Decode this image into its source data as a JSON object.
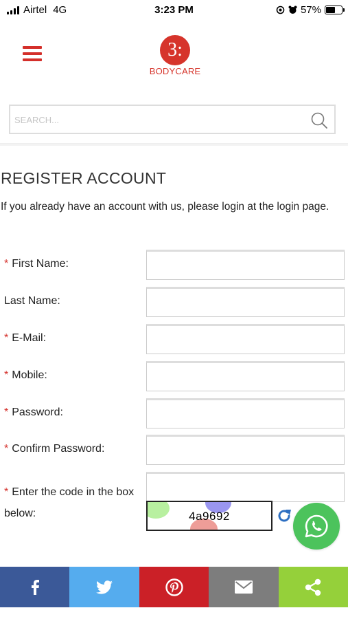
{
  "status_bar": {
    "carrier": "Airtel",
    "network": "4G",
    "time": "3:23 PM",
    "battery_percent": "57%",
    "battery_level": 0.57
  },
  "header": {
    "menu_icon": "hamburger-menu-icon",
    "logo_mark": "3:",
    "logo_text": "BODYCARE",
    "brand_color": "#d6342b"
  },
  "search": {
    "placeholder": "SEARCH...",
    "value": "",
    "icon": "search-icon"
  },
  "register": {
    "title": "REGISTER ACCOUNT",
    "intro_text": "If you already have an account with us, please login at the ",
    "login_link": "login page",
    "intro_end": "."
  },
  "form": {
    "required_marker": "*",
    "fields": [
      {
        "label": "First Name:",
        "required": true,
        "value": ""
      },
      {
        "label": "Last Name:",
        "required": false,
        "value": ""
      },
      {
        "label": "E-Mail:",
        "required": true,
        "value": ""
      },
      {
        "label": "Mobile:",
        "required": true,
        "value": ""
      },
      {
        "label": "Password:",
        "required": true,
        "value": ""
      },
      {
        "label": "Confirm Password:",
        "required": true,
        "value": ""
      }
    ],
    "captcha": {
      "label": "Enter the code in the box below:",
      "value": "",
      "code": "4a9692",
      "refresh_icon": "refresh-icon"
    }
  },
  "floating": {
    "whatsapp_icon": "whatsapp-icon",
    "color": "#4cc35c"
  },
  "share_bar": [
    {
      "name": "facebook",
      "icon": "facebook-icon",
      "color": "#3b5998"
    },
    {
      "name": "twitter",
      "icon": "twitter-icon",
      "color": "#55acee"
    },
    {
      "name": "pinterest",
      "icon": "pinterest-icon",
      "color": "#cb2027"
    },
    {
      "name": "email",
      "icon": "email-icon",
      "color": "#7d7d7d"
    },
    {
      "name": "share",
      "icon": "share-icon",
      "color": "#95d03a"
    }
  ]
}
